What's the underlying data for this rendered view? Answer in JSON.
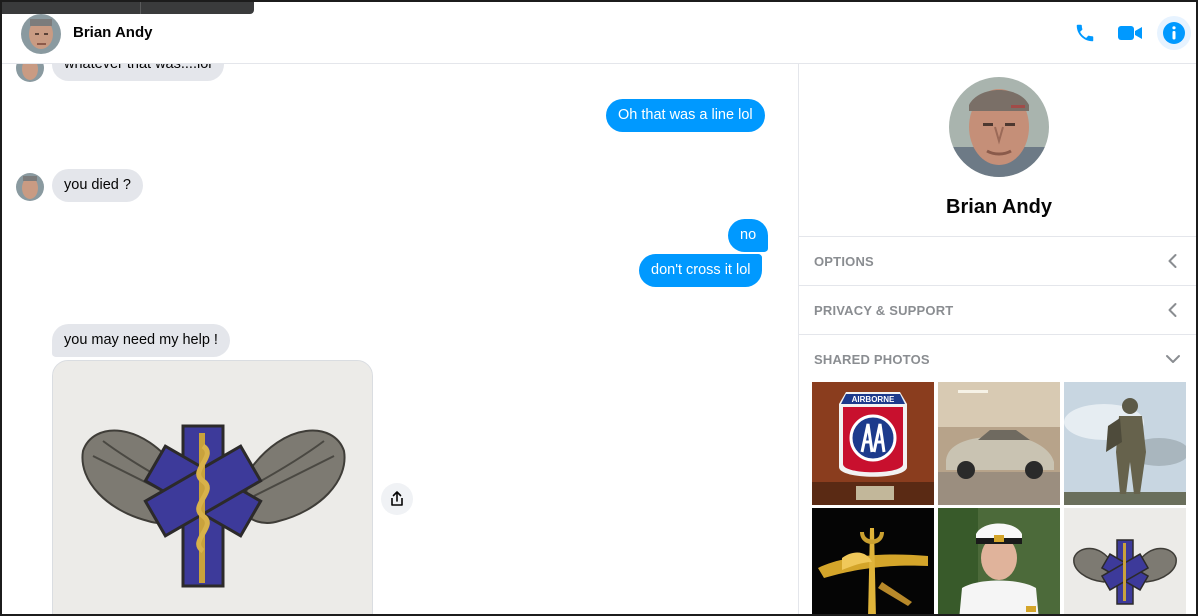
{
  "header": {
    "name": "Brian Andy"
  },
  "conversation": {
    "messages": [
      {
        "from": "contact",
        "text": "whatever that was....lol"
      },
      {
        "from": "me",
        "text": "Oh that was a line lol"
      },
      {
        "from": "contact",
        "text": "you died ?"
      },
      {
        "from": "me",
        "text": "no"
      },
      {
        "from": "me",
        "text": "don't cross it lol"
      },
      {
        "from": "contact",
        "text": "you may need my help !"
      }
    ]
  },
  "panel": {
    "name": "Brian Andy",
    "sections": [
      {
        "label": "OPTIONS",
        "state": "collapsed"
      },
      {
        "label": "PRIVACY & SUPPORT",
        "state": "collapsed"
      },
      {
        "label": "SHARED PHOTOS",
        "state": "expanded"
      }
    ],
    "shared_photos": [
      {
        "icon": "airborne-patch-photo",
        "caption": "AIRBORNE"
      },
      {
        "icon": "silver-car-photo"
      },
      {
        "icon": "soldier-silhouette-photo"
      },
      {
        "icon": "seal-trident-photo"
      },
      {
        "icon": "navy-officer-photo"
      },
      {
        "icon": "medic-wings-pin-photo"
      }
    ]
  },
  "colors": {
    "accent": "#0099ff",
    "incoming_bubble": "#e4e6eb",
    "section_label": "#8a8d91"
  }
}
